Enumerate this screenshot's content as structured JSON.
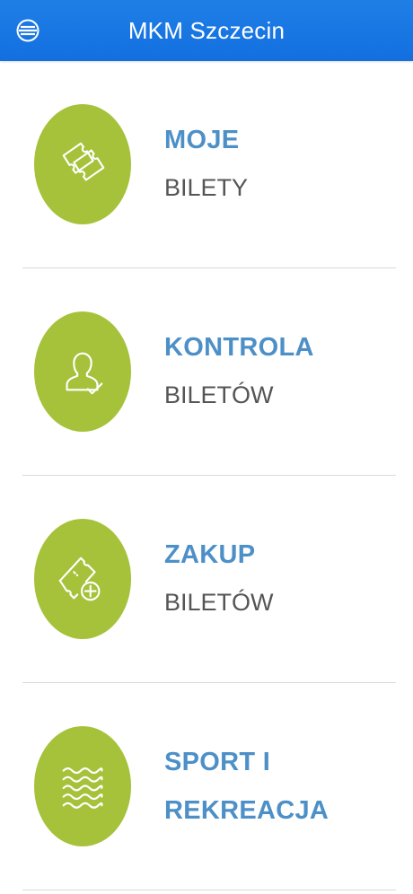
{
  "header": {
    "title": "MKM Szczecin",
    "menu_icon": "menu-icon",
    "color": "#1a78e4"
  },
  "accent_green": "#a5c23a",
  "accent_blue": "#4d90c8",
  "menu_items": [
    {
      "line1": "MOJE",
      "line2": "BILETY",
      "icon": "tickets-icon"
    },
    {
      "line1": "KONTROLA",
      "line2": "BILETÓW",
      "icon": "user-check-icon"
    },
    {
      "line1": "ZAKUP",
      "line2": "BILETÓW",
      "icon": "ticket-add-icon"
    },
    {
      "line1": "SPORT I",
      "line2": "REKREACJA",
      "icon": "waves-icon"
    }
  ]
}
